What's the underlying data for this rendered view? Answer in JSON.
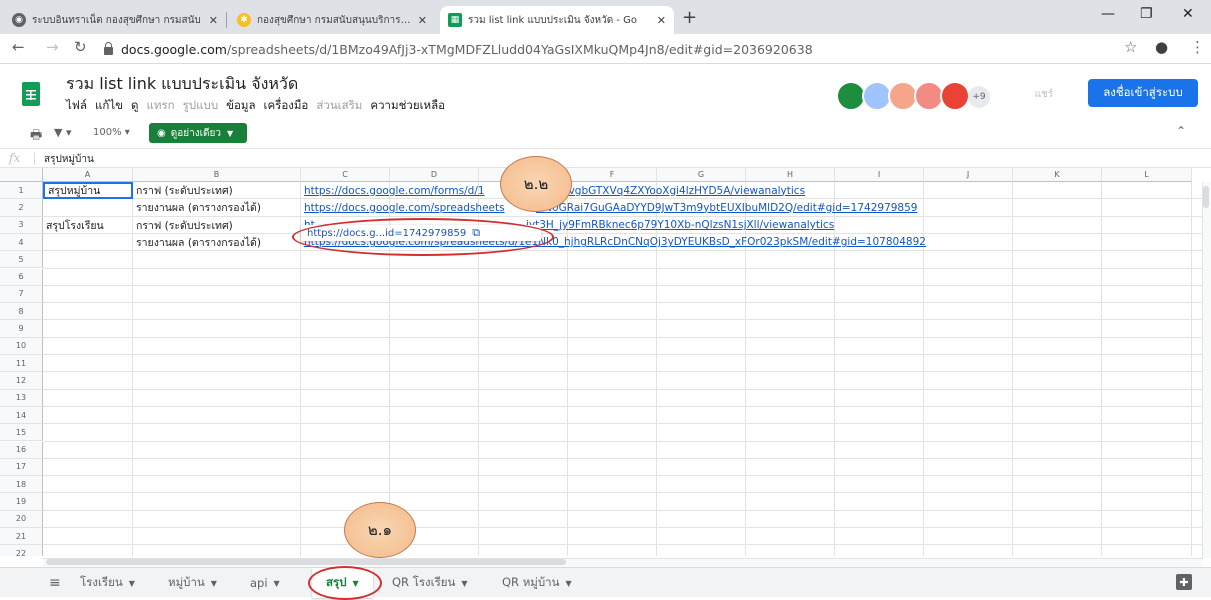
{
  "browser": {
    "tabs": [
      {
        "title": "ระบบอินทราเน็ต กองสุขศึกษา กรมสนับ",
        "favicon_color": "#5f6368"
      },
      {
        "title": "กองสุขศึกษา กรมสนับสนุนบริการสุขภา",
        "favicon_color": "#f6bf26"
      },
      {
        "title": "รวม list link แบบประเมิน จังหวัด - Go",
        "favicon_color": "#0f9d58"
      }
    ],
    "new_tab": "+",
    "url_host": "docs.google.com",
    "url_path": "/spreadsheets/d/1BMzo49AfJj3-xTMgMDFZLludd04YaGsIXMkuQMp4Jn8/edit#gid=2036920638"
  },
  "sheet": {
    "title": "รวม list link แบบประเมิน จังหวัด",
    "menu": [
      {
        "label": "ไฟล์",
        "dim": false
      },
      {
        "label": "แก้ไข",
        "dim": false
      },
      {
        "label": "ดู",
        "dim": false
      },
      {
        "label": "แทรก",
        "dim": true
      },
      {
        "label": "รูปแบบ",
        "dim": true
      },
      {
        "label": "ข้อมูล",
        "dim": false
      },
      {
        "label": "เครื่องมือ",
        "dim": false
      },
      {
        "label": "ส่วนเสริม",
        "dim": true
      },
      {
        "label": "ความช่วยเหลือ",
        "dim": false
      }
    ],
    "avatar_colors": [
      "#1e8e3e",
      "#a0c4ff",
      "#f4a58a",
      "#f28b82",
      "#ea4335"
    ],
    "more_viewers": "+9",
    "share_label": "แชร์",
    "signin_label": "ลงชื่อเข้าสู่ระบบ"
  },
  "toolbar": {
    "zoom": "100%",
    "view_only_label": "ดูอย่างเดียว"
  },
  "formula_bar": {
    "fx": "fx",
    "content": "สรุปหมู่บ้าน"
  },
  "grid": {
    "columns": [
      "A",
      "B",
      "C",
      "D",
      "E",
      "F",
      "G",
      "H",
      "I",
      "J",
      "K",
      "L"
    ],
    "rows": [
      "1",
      "2",
      "3",
      "4",
      "5",
      "6",
      "7",
      "8",
      "9",
      "10",
      "11",
      "12",
      "13",
      "14",
      "15",
      "16",
      "17",
      "18",
      "19",
      "20",
      "21",
      "22"
    ],
    "cells": {
      "A1": "สรุปหมู่บ้าน",
      "B1": "กราฟ (ระดับประเทศ)",
      "C1": "https://docs.google.com/forms/d/1",
      "E1": "UpFzqvgbGTXVq4ZXYooXgi4lzHYD5A/viewanalytics",
      "B2": "รายงานผล (ตารางกรองได้)",
      "C2": "https://docs.google.com/spreadsheets",
      "E2": "DN0GRai7GuGAaDYYD9JwT3m9ybtEUXIbuMlD2Q/edit#gid=1742979859",
      "A3": "สรุปโรงเรียน",
      "B3": "กราฟ (ระดับประเทศ)",
      "C3": "ht",
      "E3": "iyt3H_jy9FmRBknec6p79Y10Xb-nQlzsN1sjXll/viewanalytics",
      "B4": "รายงานผล (ตารางกรองได้)",
      "C4": "https://docs.google.com/spreadsheets/d/1e1Nk0_hjhgRLRcDnCNqOj3yDYEUKBsD_xFOr023pkSM/edit#gid=107804892"
    },
    "link_tooltip": "https://docs.g...id=1742979859"
  },
  "sheet_tabs": [
    {
      "label": "โรงเรียน",
      "active": false
    },
    {
      "label": "หมู่บ้าน",
      "active": false
    },
    {
      "label": "api",
      "active": false
    },
    {
      "label": "สรุป",
      "active": true
    },
    {
      "label": "QR โรงเรียน",
      "active": false
    },
    {
      "label": "QR หมู่บ้าน",
      "active": false
    }
  ],
  "annotations": {
    "bubble_top": "๒.๒",
    "bubble_bottom": "๒.๑",
    "highlight_color": "#d32f2f"
  }
}
